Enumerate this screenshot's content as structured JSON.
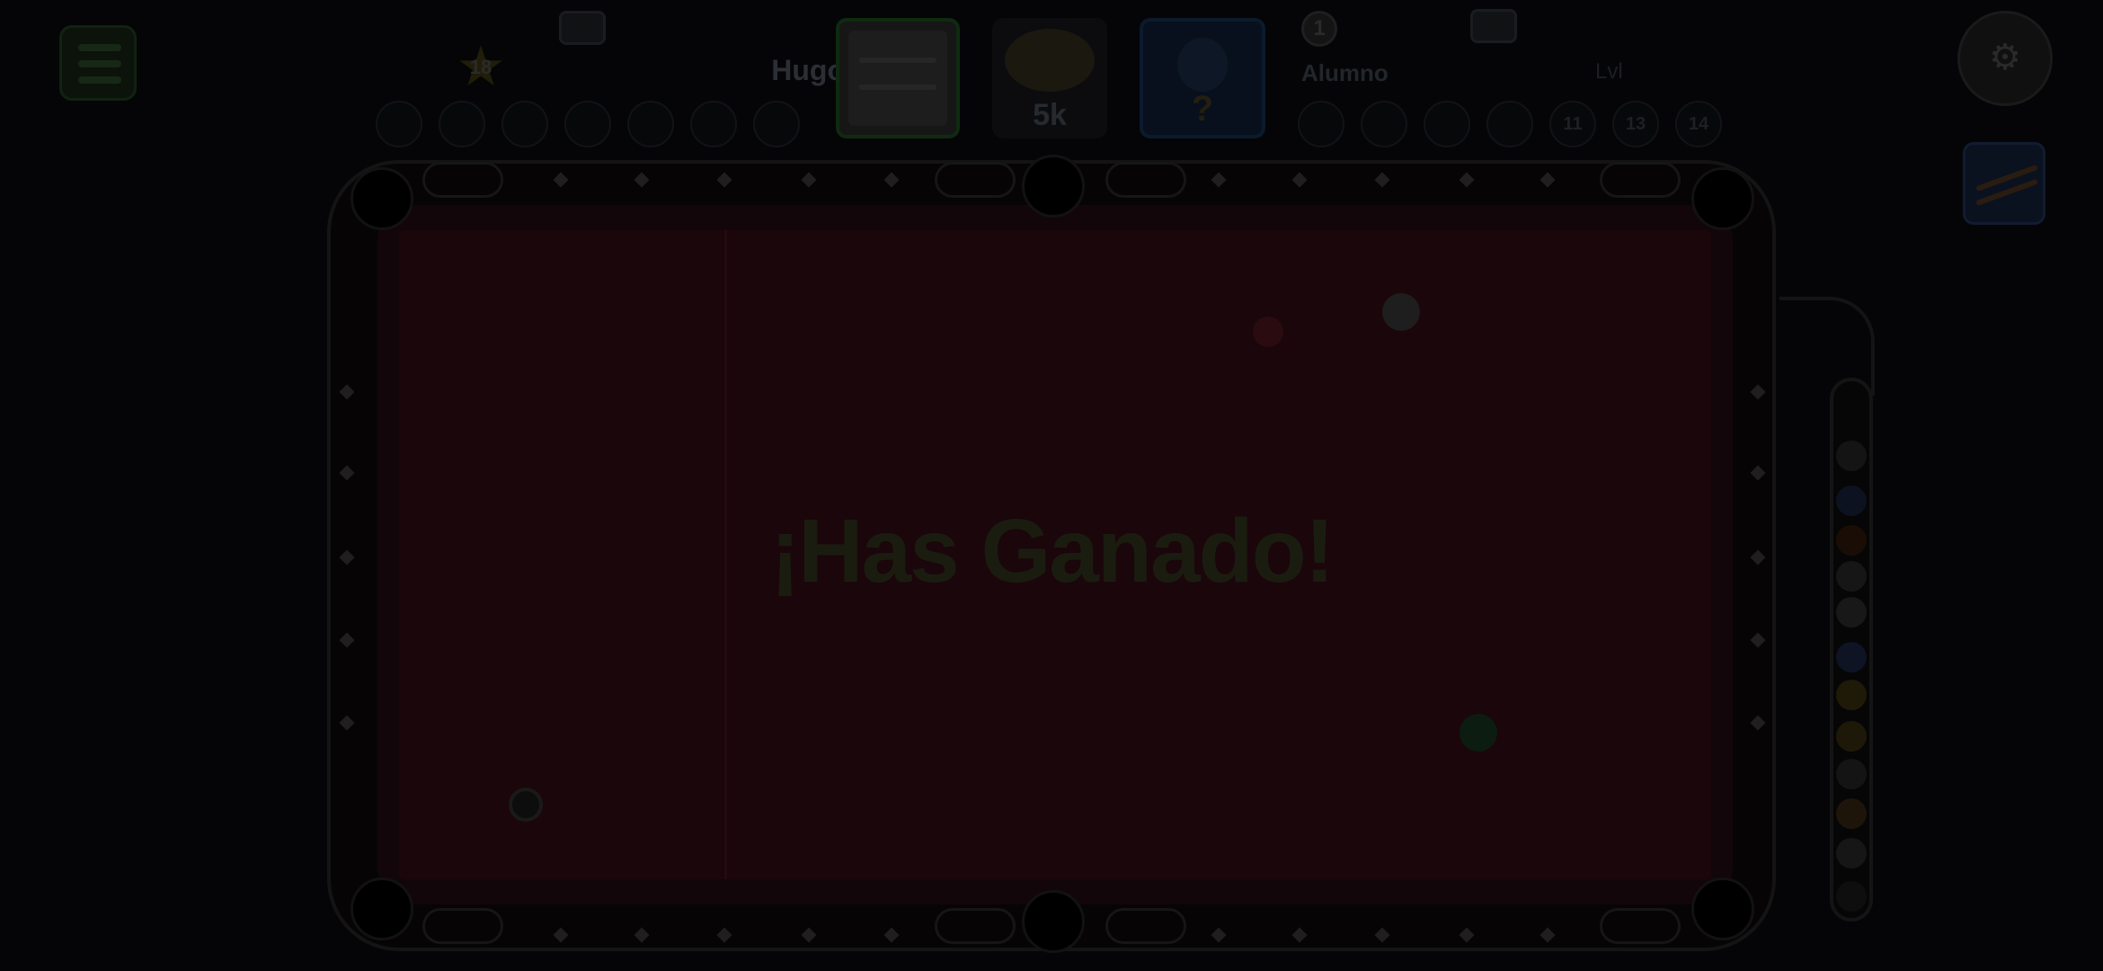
{
  "top_bar": {
    "player_level": "18",
    "player_name": "Hugo",
    "prize_amount": "5k",
    "opponent_avatar_placeholder": "?",
    "opponent_rank": "1",
    "opponent_name": "Alumno",
    "opponent_level": "Lvl",
    "opponent_ball_slots": [
      "",
      "",
      "",
      "",
      "11",
      "13",
      "14"
    ]
  },
  "game": {
    "win_message": "¡Has Ganado!",
    "win_subtitle": ""
  },
  "icons": {
    "menu": "menu-icon",
    "settings": "settings-icon",
    "cue": "cue-icon",
    "chat": "chat-icon"
  },
  "colors": {
    "overlay": "#050507",
    "felt": "#1a060b",
    "rail": "#12060a",
    "win_text": "#1b1c10"
  }
}
